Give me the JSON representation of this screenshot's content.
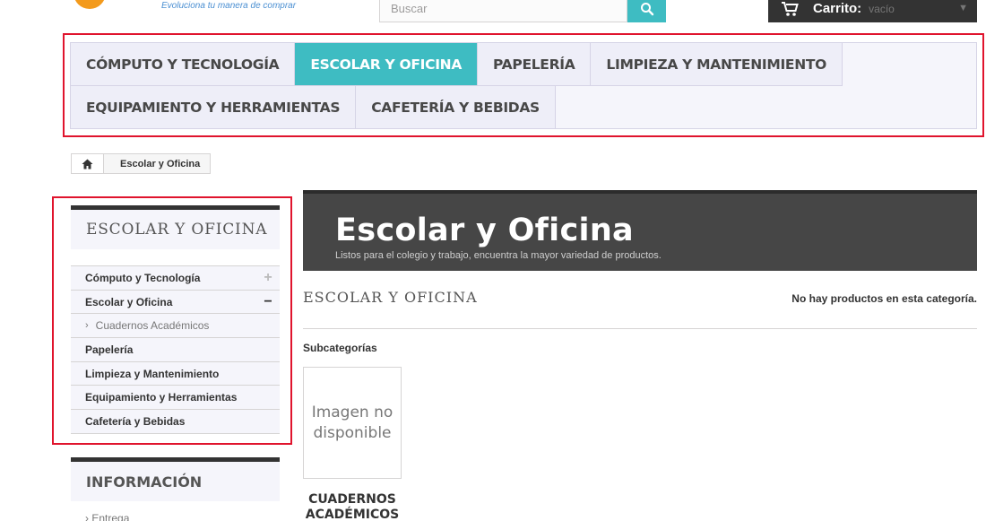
{
  "header": {
    "logo_tagline": "Evoluciona tu manera de comprar",
    "search_placeholder": "Buscar",
    "cart_label": "Carrito:",
    "cart_status": "vacío"
  },
  "menu": {
    "items": [
      {
        "label": "CÓMPUTO Y TECNOLOGÍA",
        "active": false
      },
      {
        "label": "ESCOLAR Y OFICINA",
        "active": true
      },
      {
        "label": "PAPELERÍA",
        "active": false
      },
      {
        "label": "LIMPIEZA Y MANTENIMIENTO",
        "active": false
      },
      {
        "label": "EQUIPAMIENTO Y HERRAMIENTAS",
        "active": false
      },
      {
        "label": "CAFETERÍA Y BEBIDAS",
        "active": false
      }
    ]
  },
  "breadcrumb": {
    "current": "Escolar y Oficina"
  },
  "sidebar": {
    "title": "ESCOLAR Y OFICINA",
    "categories": [
      {
        "label": "Cómputo y Tecnología",
        "toggle": "+"
      },
      {
        "label": "Escolar y Oficina",
        "toggle": "−"
      },
      {
        "label": "Cuadernos Académicos",
        "sub": true
      },
      {
        "label": "Papelería"
      },
      {
        "label": "Limpieza y Mantenimiento"
      },
      {
        "label": "Equipamiento y Herramientas"
      },
      {
        "label": "Cafetería y Bebidas"
      }
    ],
    "info_title": "INFORMACIÓN",
    "info_items": [
      "Entrega"
    ]
  },
  "main": {
    "banner_title": "Escolar y Oficina",
    "banner_description": "Listos para el colegio y trabajo, encuentra la mayor variedad de productos.",
    "section_heading": "ESCOLAR Y OFICINA",
    "no_products": "No hay productos en esta categoría.",
    "subcategories_label": "Subcategorías",
    "subcategory": {
      "image_placeholder_line1": "Imagen no",
      "image_placeholder_line2": "disponible",
      "name": "CUADERNOS ACADÉMICOS"
    }
  },
  "colors": {
    "accent": "#3ebcc2",
    "dark": "#333333",
    "highlight": "#e0142d",
    "logo_orange": "#f39a1c"
  }
}
